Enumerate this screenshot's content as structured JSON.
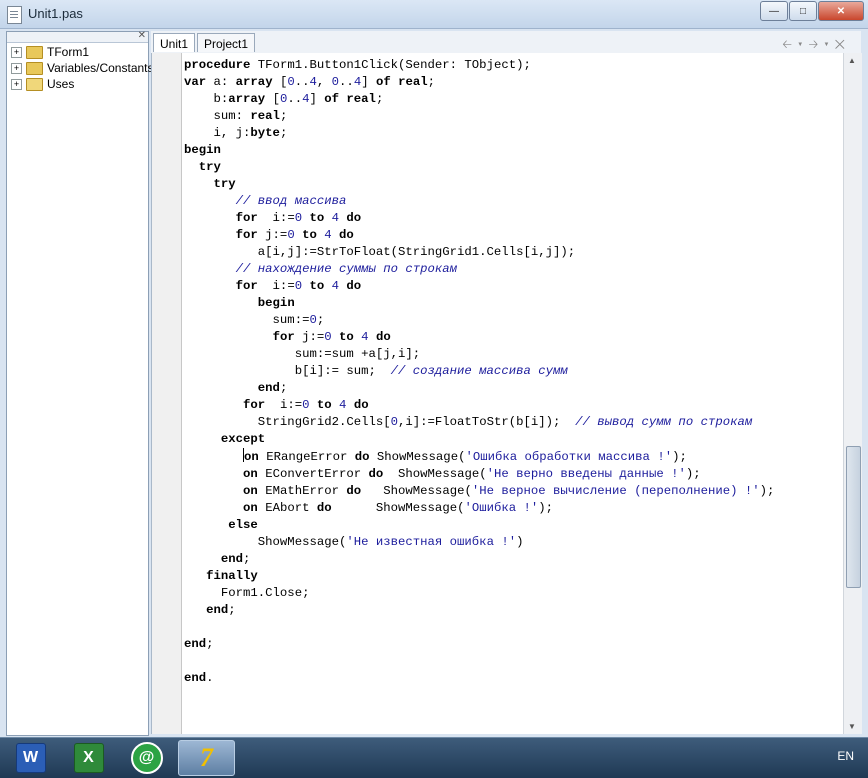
{
  "window": {
    "title": "Unit1.pas"
  },
  "tree": {
    "items": [
      "TForm1",
      "Variables/Constants",
      "Uses"
    ]
  },
  "tabs": [
    "Unit1",
    "Project1"
  ],
  "code_lines": [
    "procedure TForm1.Button1Click(Sender: TObject);",
    "var a: array [0..4, 0..4] of real;",
    "    b:array [0..4] of real;",
    "    sum: real;",
    "    i, j:byte;",
    "begin",
    "  try",
    "    try",
    "       // ввод массива",
    "       for  i:=0 to 4 do",
    "       for j:=0 to 4 do",
    "          a[i,j]:=StrToFloat(StringGrid1.Cells[i,j]);",
    "       // нахождение суммы по строкам",
    "       for  i:=0 to 4 do",
    "          begin",
    "            sum:=0;",
    "            for j:=0 to 4 do",
    "               sum:=sum +a[j,i];",
    "               b[i]:= sum;  // создание массива сумм",
    "          end;",
    "        for  i:=0 to 4 do",
    "          StringGrid2.Cells[0,i]:=FloatToStr(b[i]);  // вывод сумм по строкам",
    "     except",
    "        on ERangeError do ShowMessage('Ошибка обработки массива !');",
    "        on EConvertError do  ShowMessage('Не верно введены данные !');",
    "        on EMathError do   ShowMessage('Не верное вычисление (переполнение) !');",
    "        on EAbort do      ShowMessage('Ошибка !');",
    "      else",
    "          ShowMessage('Не известная ошибка !')",
    "     end;",
    "   finally",
    "     Form1.Close;",
    "   end;",
    "",
    "end;",
    "",
    "end."
  ],
  "taskbar": {
    "language": "EN",
    "apps": [
      "word-icon",
      "excel-icon",
      "mail-agent-icon",
      "pascal-abc-icon"
    ]
  }
}
